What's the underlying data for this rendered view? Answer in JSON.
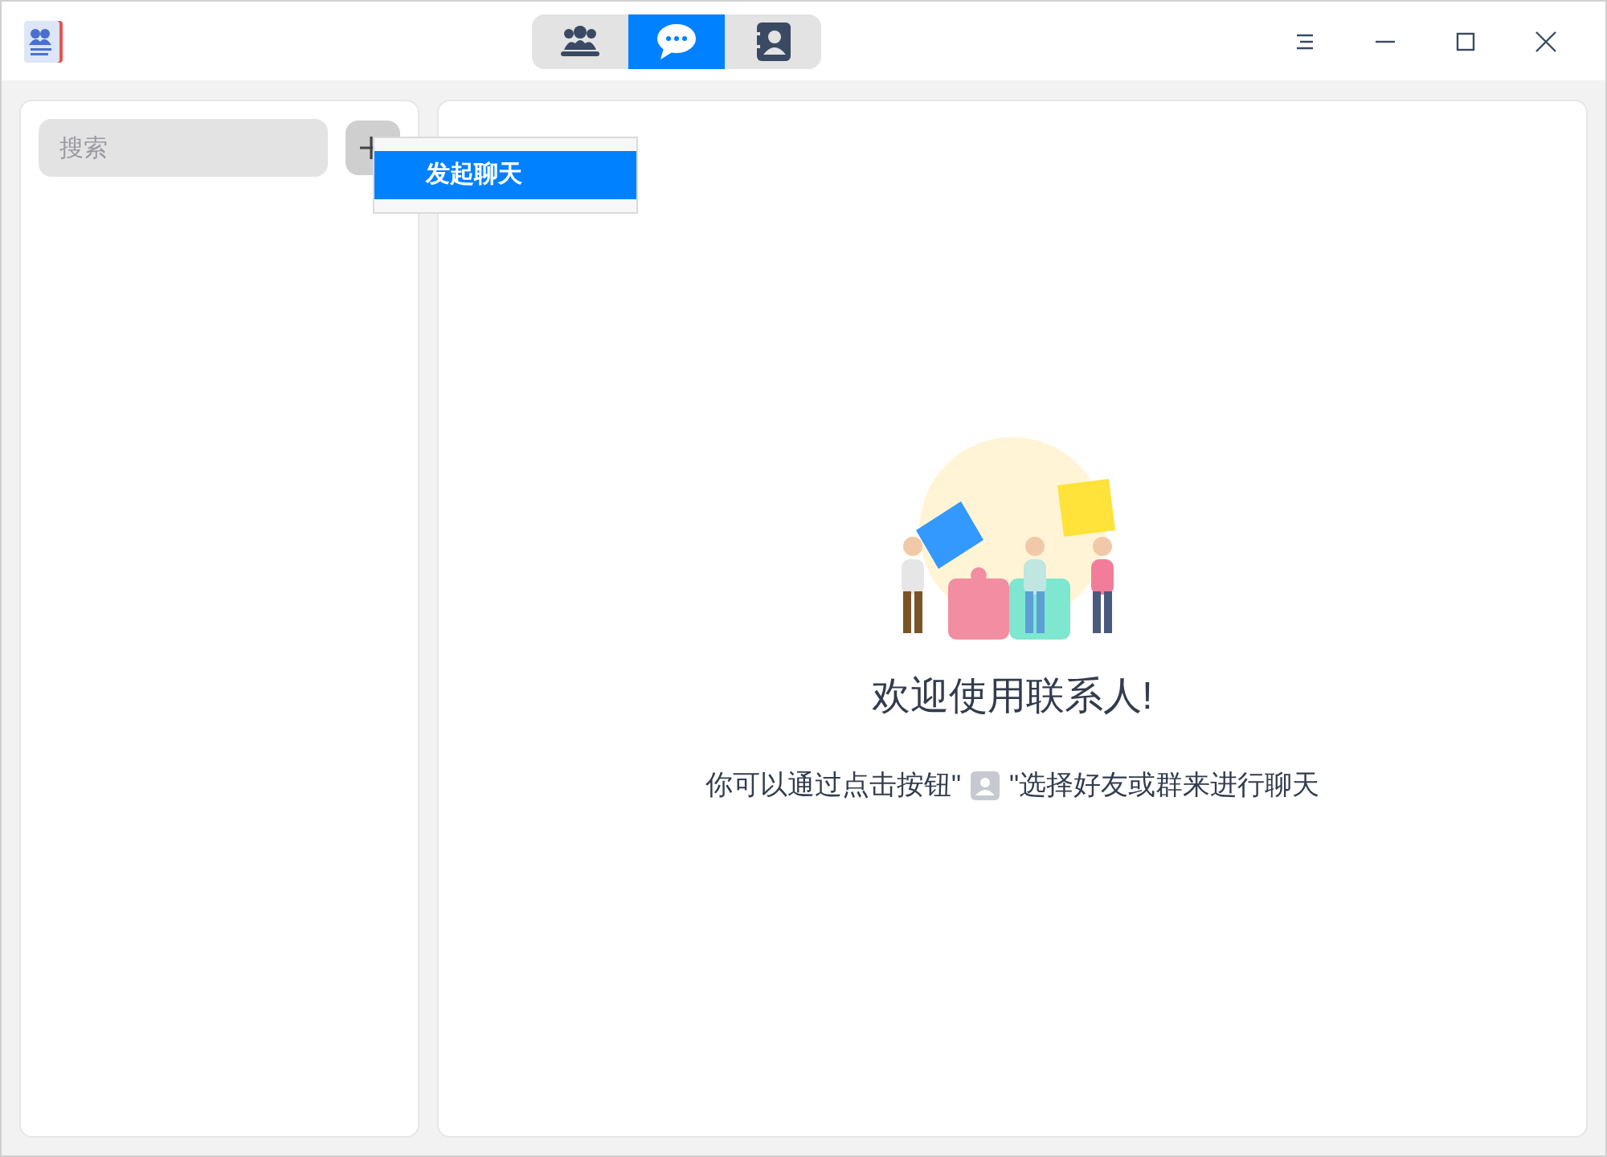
{
  "tabs": [
    {
      "kind": "groups",
      "selected": false
    },
    {
      "kind": "chat",
      "selected": true
    },
    {
      "kind": "contacts",
      "selected": false
    }
  ],
  "search": {
    "placeholder": "搜索"
  },
  "menu": {
    "items": [
      {
        "label": "发起聊天",
        "selected": true
      }
    ]
  },
  "welcome": {
    "title": "欢迎使用联系人!",
    "hint_before": "你可以通过点击按钮\"",
    "hint_after": "\"选择好友或群来进行聊天"
  }
}
